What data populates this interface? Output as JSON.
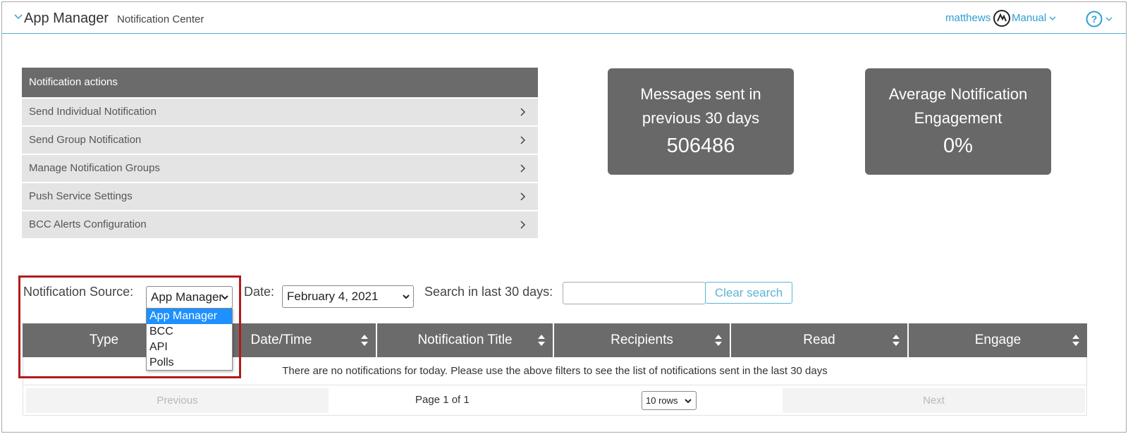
{
  "header": {
    "app_title": "App Manager",
    "subtitle": "Notification Center",
    "user": "matthews",
    "manual": "Manual",
    "accent_color": "#2e9ed1"
  },
  "actions": {
    "heading": "Notification actions",
    "items": [
      {
        "label": "Send Individual Notification"
      },
      {
        "label": "Send Group Notification"
      },
      {
        "label": "Manage Notification Groups"
      },
      {
        "label": "Push Service Settings"
      },
      {
        "label": "BCC Alerts Configuration"
      }
    ]
  },
  "stats": {
    "messages": {
      "label_line1": "Messages sent in",
      "label_line2": "previous 30 days",
      "value": "506486"
    },
    "engagement": {
      "label_line1": "Average Notification",
      "label_line2": "Engagement",
      "value": "0%"
    }
  },
  "filters": {
    "source_label": "Notification Source:",
    "source_value": "App Manager",
    "source_options": [
      "App Manager",
      "BCC",
      "API",
      "Polls"
    ],
    "date_label": "Date:",
    "date_value": "February 4, 2021",
    "search_label": "Search in last 30 days:",
    "search_value": "",
    "clear_label": "Clear search"
  },
  "table": {
    "columns": [
      "Type",
      "Date/Time",
      "Notification Title",
      "Recipients",
      "Read",
      "Engage"
    ],
    "empty_message": "There are no notifications for today. Please use the above filters to see the list of notifications sent in the last 30 days"
  },
  "pager": {
    "prev": "Previous",
    "next": "Next",
    "page_info": "Page 1 of 1",
    "rows": "10 rows"
  }
}
